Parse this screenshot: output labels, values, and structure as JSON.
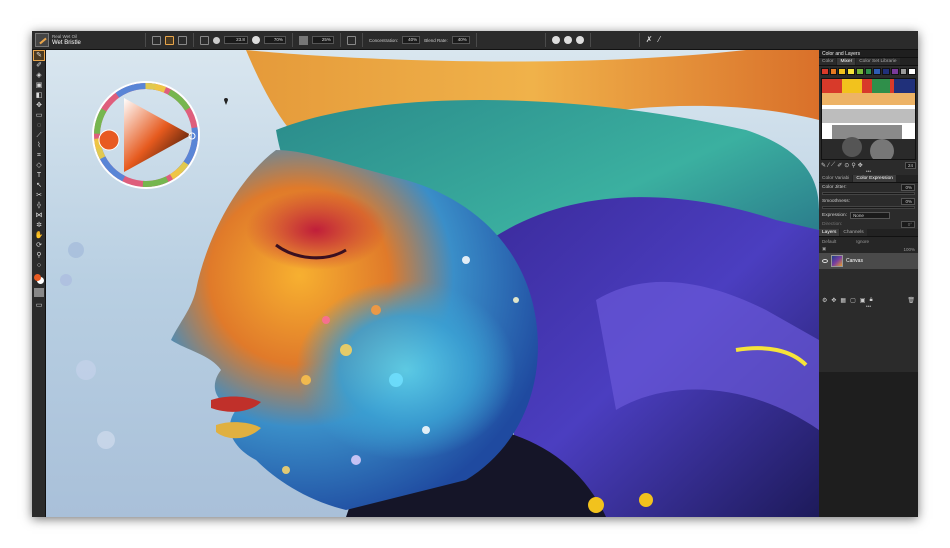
{
  "brush": {
    "category": "Real Wet Oil",
    "variant": "Wet Bristle"
  },
  "property_bar": {
    "size_value": "23.8",
    "opacity_value": "70%",
    "grain_value": "25%",
    "concentration_label": "Concentration:",
    "concentration_value": "40%",
    "blend_rate_label": "Blend Rate:",
    "blend_rate_value": "40%"
  },
  "colors": {
    "accent": "#e8a54b",
    "main_color": "#e85a22",
    "additional_color": "#ffffff",
    "panel_bg": "#2b2b2b"
  },
  "panels": {
    "color_and_layers_title": "Color and Layers",
    "color_tabs": [
      "Color",
      "Mixer",
      "Color Set Librarie"
    ],
    "active_color_tab": "Mixer",
    "mixer_swatches": [
      "#d83a2a",
      "#e87a22",
      "#f2c21d",
      "#f6e33a",
      "#78b83a",
      "#2f8f4a",
      "#2e5db5",
      "#20307a",
      "#7a3a9a",
      "#9a9a9a",
      "#ffffff",
      "#e8e8e8"
    ],
    "mixer_zoom_value": "24",
    "variability_tabs": [
      "Color Variabi",
      "Color Expression"
    ],
    "active_variability_tab": "Color Expression",
    "color_jitter_label": "Color Jitter:",
    "color_jitter_value": "0%",
    "smoothness_label": "Smoothness:",
    "smoothness_value": "0%",
    "expression_label": "Expression:",
    "expression_value": "None",
    "direction_label": "Direction:",
    "direction_value": "0°",
    "layer_tabs": [
      "Layers",
      "Channels"
    ],
    "active_layer_tab": "Layers",
    "composite_method": "Default",
    "composite_depth": "Ignore",
    "layer_opacity": "100%",
    "layers": [
      {
        "name": "Canvas"
      }
    ]
  },
  "toolbox": {
    "tools": [
      "brush-icon",
      "dropper-icon",
      "paint-bucket-icon",
      "bucket-icon",
      "eraser-icon",
      "transform-icon",
      "rectangle-select-icon",
      "lasso-icon",
      "magic-wand-icon",
      "pen-icon",
      "crop-icon",
      "shape-icon",
      "text-icon",
      "selection-adjuster-icon",
      "symmetry-icon",
      "perspective-icon",
      "mirror-icon",
      "kaleidoscope-icon",
      "grabber-icon",
      "rotate-page-icon",
      "magnifier-icon",
      "layer-adjuster-icon"
    ],
    "active_tool": "brush-icon"
  }
}
